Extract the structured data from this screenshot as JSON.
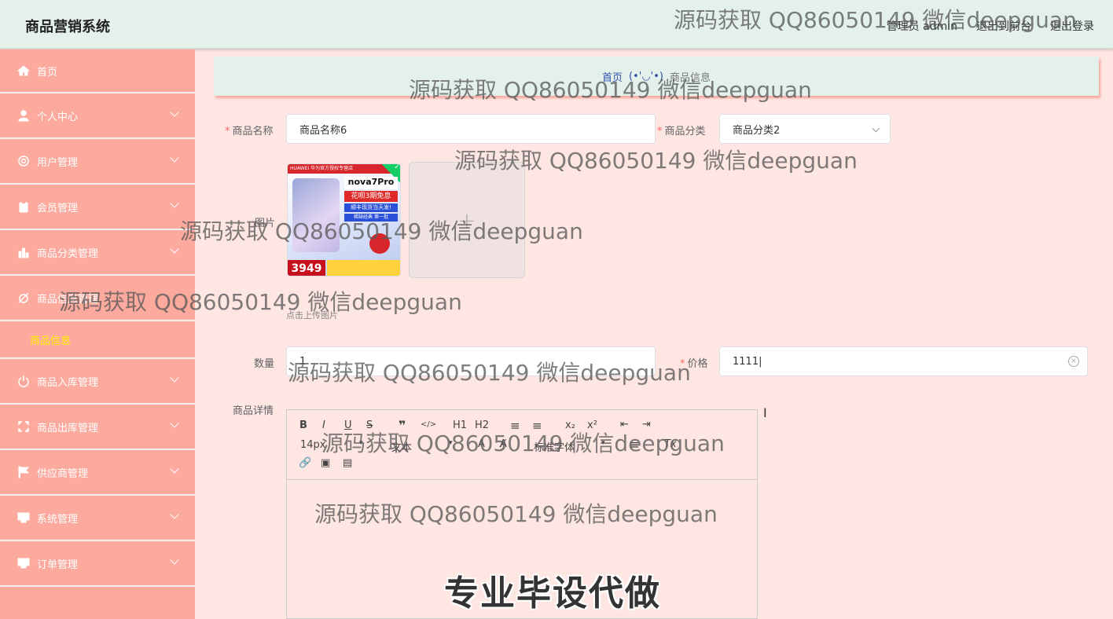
{
  "header": {
    "title": "商品营销系统",
    "user": "管理员 admin",
    "front_link": "退出到前台",
    "logout": "退出登录"
  },
  "sidebar": {
    "items": [
      {
        "label": "首页",
        "icon": "home-icon"
      },
      {
        "label": "个人中心",
        "icon": "user-icon"
      },
      {
        "label": "用户管理",
        "icon": "users-icon"
      },
      {
        "label": "会员管理",
        "icon": "member-icon"
      },
      {
        "label": "商品分类管理",
        "icon": "bar-chart-icon"
      },
      {
        "label": "商品信息管理",
        "icon": "tag-icon"
      },
      {
        "label": "商品入库管理",
        "icon": "power-icon"
      },
      {
        "label": "商品出库管理",
        "icon": "expand-icon"
      },
      {
        "label": "供应商管理",
        "icon": "flag-icon"
      },
      {
        "label": "系统管理",
        "icon": "monitor-icon"
      },
      {
        "label": "订单管理",
        "icon": "monitor-icon"
      }
    ],
    "active_submenu": "商品信息"
  },
  "breadcrumb": {
    "home": "首页",
    "separator": "(•'◡'•)",
    "current": "商品信息"
  },
  "form": {
    "name_label": "商品名称",
    "name_value": "商品名称6",
    "category_label": "商品分类",
    "category_value": "商品分类2",
    "image_label": "图片",
    "upload_tip": "点击上传图片",
    "quantity_label": "数量",
    "quantity_value": "1",
    "price_label": "价格",
    "price_value": "1111",
    "detail_label": "商品详情"
  },
  "product_image": {
    "store_bar": "HUAWEI 华为官方授权专营店",
    "model": "nova7Pro",
    "promo": "花呗3期免息",
    "promo2": "顺丰现货当天发!",
    "promo3": "稀缺经典 第一批",
    "price": "3949"
  },
  "editor": {
    "toolbar_row1": [
      "B",
      "I",
      "U",
      "S",
      "❞",
      "</>",
      "H1",
      "H2",
      "≡",
      "≡",
      "x₂",
      "x²",
      "⇤",
      "⇥"
    ],
    "font_size": "14px",
    "text_style": "文本",
    "font_family": "标准字体",
    "content_text": "专业毕设代做"
  },
  "watermark_text": "源码获取 QQ86050149 微信deepguan",
  "colors": {
    "header_bg": "#e3f1ea",
    "sidebar_bg": "#fdaa9e",
    "content_bg": "#fee6e2",
    "active_submenu": "#fff200",
    "required": "#f56c6c"
  }
}
